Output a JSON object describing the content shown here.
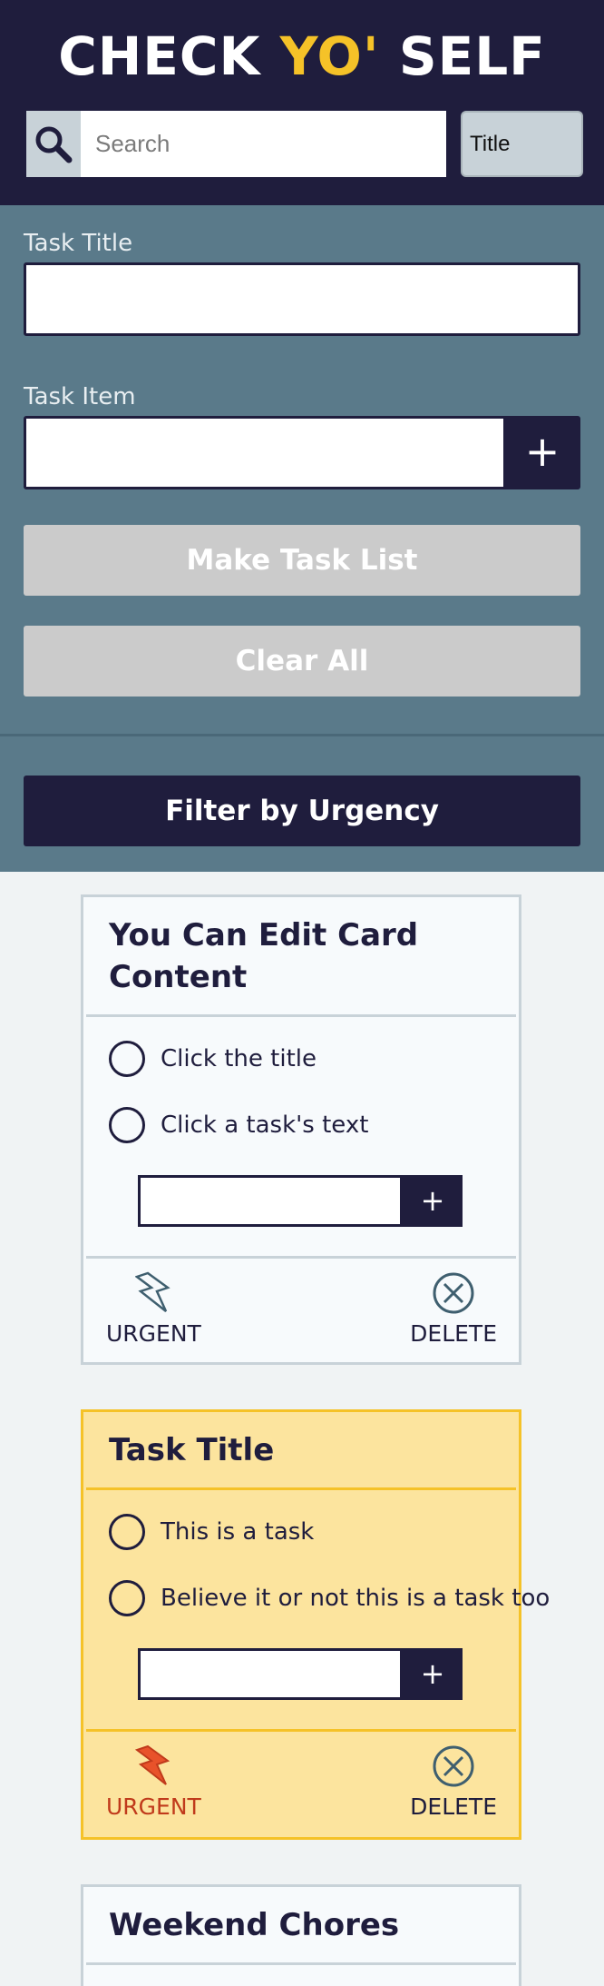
{
  "header": {
    "title_part1": "CHECK ",
    "title_accent": "YO'",
    "title_part2": " SELF",
    "search_placeholder": "Search",
    "filter_value": "Title",
    "search_icon": "search-icon"
  },
  "form": {
    "task_title_label": "Task Title",
    "task_item_label": "Task Item",
    "add_item_symbol": "+",
    "make_list_label": "Make Task List",
    "clear_all_label": "Clear All",
    "filter_urgency_label": "Filter by Urgency"
  },
  "colors": {
    "navy": "#1f1d3d",
    "accent_yellow": "#f5c228",
    "panel": "#5a7a8a",
    "urgent_card": "#fce49e",
    "urgent_red": "#c03a1b"
  },
  "cards": [
    {
      "title": "You Can Edit Card Content",
      "tasks": [
        "Click the title",
        "Click a task's text"
      ],
      "add_symbol": "+",
      "urgent_label": "URGENT",
      "delete_label": "DELETE",
      "urgent": false
    },
    {
      "title": "Task Title",
      "tasks": [
        "This is a task",
        "Believe it or not this is a task too"
      ],
      "add_symbol": "+",
      "urgent_label": "URGENT",
      "delete_label": "DELETE",
      "urgent": true
    },
    {
      "title": "Weekend Chores",
      "urgent": false
    }
  ]
}
